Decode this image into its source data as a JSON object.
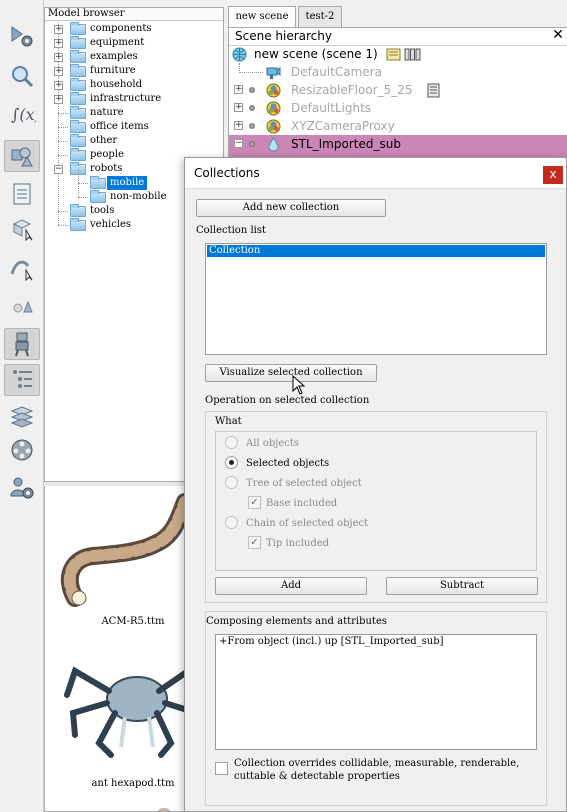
{
  "model_browser": {
    "title": "Model browser",
    "items": [
      {
        "label": "components",
        "expandable": true
      },
      {
        "label": "equipment",
        "expandable": true
      },
      {
        "label": "examples",
        "expandable": true
      },
      {
        "label": "furniture",
        "expandable": true
      },
      {
        "label": "household",
        "expandable": true
      },
      {
        "label": "infrastructure",
        "expandable": true
      },
      {
        "label": "nature",
        "expandable": false
      },
      {
        "label": "office items",
        "expandable": false
      },
      {
        "label": "other",
        "expandable": false
      },
      {
        "label": "people",
        "expandable": false
      },
      {
        "label": "robots",
        "expandable": true,
        "expanded": true
      },
      {
        "label": "mobile",
        "child": true,
        "selected": true
      },
      {
        "label": "non-mobile",
        "child": true
      },
      {
        "label": "tools",
        "expandable": false
      },
      {
        "label": "vehicles",
        "expandable": false
      }
    ],
    "thumbnails": [
      {
        "label": "ACM-R5.ttm"
      },
      {
        "label": "ant hexapod.ttm"
      }
    ]
  },
  "tabs": [
    {
      "label": "new scene",
      "active": true
    },
    {
      "label": "test-2",
      "active": false
    }
  ],
  "scene_hierarchy": {
    "title": "Scene hierarchy",
    "close_glyph": "✕",
    "items": [
      {
        "label": "new scene (scene 1)",
        "icon": "globe-icon"
      },
      {
        "label": "DefaultCamera",
        "icon": "camera-icon",
        "dim": true
      },
      {
        "label": "ResizableFloor_5_25",
        "icon": "shape-icon",
        "dim": true
      },
      {
        "label": "DefaultLights",
        "icon": "shape-icon",
        "dim": true
      },
      {
        "label": "XYZCameraProxy",
        "icon": "shape-icon",
        "dim": true
      },
      {
        "label": "STL_Imported_sub",
        "icon": "drop-icon",
        "selected": true
      }
    ]
  },
  "dialog": {
    "title": "Collections",
    "close_glyph": "x",
    "add_new_collection": "Add new collection",
    "collection_list_label": "Collection list",
    "collection_items": [
      "Collection"
    ],
    "visualize_button": "Visualize selected collection",
    "operation_label": "Operation on selected collection",
    "what_label": "What",
    "options": [
      {
        "label": "All objects",
        "checked": false,
        "enabled": false
      },
      {
        "label": "Selected objects",
        "checked": true,
        "enabled": true
      },
      {
        "label": "Tree of selected object",
        "checked": false,
        "enabled": false
      },
      {
        "label": "Chain of selected object",
        "checked": false,
        "enabled": false
      }
    ],
    "base_included": "Base included",
    "tip_included": "Tip included",
    "add_button": "Add",
    "subtract_button": "Subtract",
    "composing_label": "Composing elements and attributes",
    "composing_items": [
      "+From object (incl.) up [STL_Imported_sub]"
    ],
    "override_label_line1": "Collection overrides collidable, measurable, renderable,",
    "override_label_line2": "cuttable & detectable properties",
    "override_checked": false
  },
  "colors": {
    "selection_blue": "#0078d7",
    "scene_selection": "#c986b6",
    "close_red": "#c42b1c"
  }
}
